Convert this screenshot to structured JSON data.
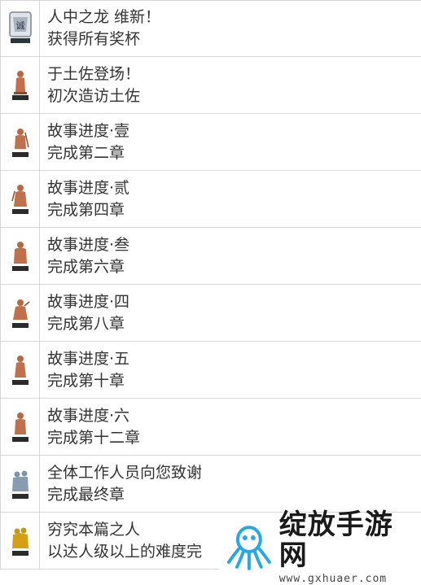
{
  "achievements": [
    {
      "title": "人中之龙 维新！",
      "desc": "获得所有奖杯",
      "icon": "platinum-trophy-icon"
    },
    {
      "title": "于土佐登场！",
      "desc": "初次造访土佐",
      "icon": "bronze-trophy-icon"
    },
    {
      "title": "故事进度·壹",
      "desc": "完成第二章",
      "icon": "bronze-trophy-icon"
    },
    {
      "title": "故事进度·贰",
      "desc": "完成第四章",
      "icon": "bronze-trophy-icon"
    },
    {
      "title": "故事进度·叁",
      "desc": "完成第六章",
      "icon": "bronze-trophy-icon"
    },
    {
      "title": "故事进度·四",
      "desc": "完成第八章",
      "icon": "bronze-trophy-icon"
    },
    {
      "title": "故事进度·五",
      "desc": "完成第十章",
      "icon": "bronze-trophy-icon"
    },
    {
      "title": "故事进度·六",
      "desc": "完成第十二章",
      "icon": "bronze-trophy-icon"
    },
    {
      "title": "全体工作人员向您致谢",
      "desc": "完成最终章",
      "icon": "silver-trophy-icon"
    },
    {
      "title": "穷究本篇之人",
      "desc": "以达人级以上的难度完",
      "icon": "gold-trophy-icon"
    }
  ],
  "watermark": {
    "title": "绽放手游网",
    "url": "www.gxhuaer.com",
    "logo_icon": "octopus-logo-icon"
  },
  "colors": {
    "border": "#d6d6d6",
    "text": "#333333",
    "bronze": "#c0704a",
    "silver": "#8a9bb0",
    "gold": "#d4a017",
    "logo": "#2aa7e0"
  }
}
